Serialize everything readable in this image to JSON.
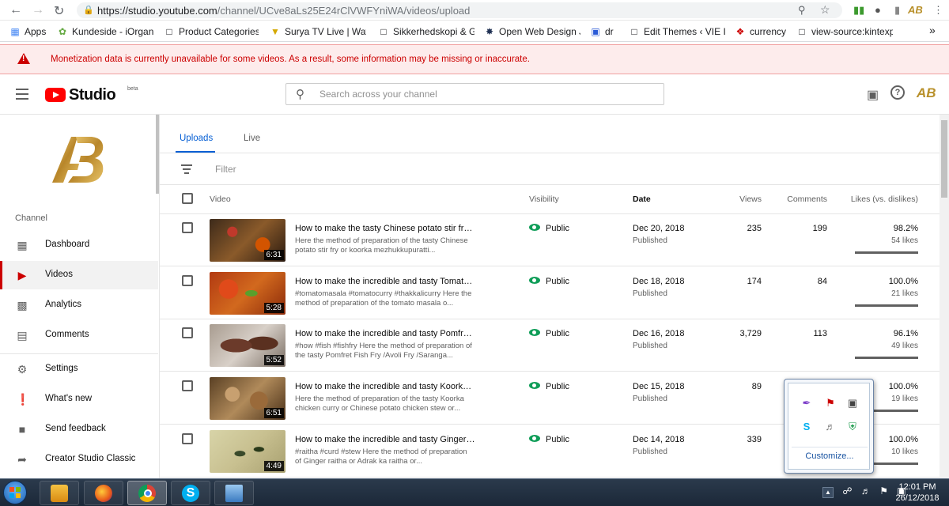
{
  "browser": {
    "url_host": "https://studio.youtube.com",
    "url_path": "/channel/UCve8aLs25E24rClVWFYniWA/videos/upload",
    "bookmarks": [
      "Apps",
      "Kundeside - iOrganic",
      "Product Categories ‹",
      "Surya TV Live | Watch",
      "Sikkerhedskopi & Ge",
      "Open Web Design Jo",
      "dr",
      "Edit Themes ‹ VIE INV",
      "currency",
      "view-source:kintexph"
    ],
    "more": "»"
  },
  "banner": {
    "message": "Monetization data is currently unavailable for some videos. As a result, some information may be missing or inaccurate."
  },
  "header": {
    "logo_text": "Studio",
    "beta": "beta",
    "search_placeholder": "Search across your channel"
  },
  "sidebar": {
    "section_label": "Channel",
    "items": [
      {
        "label": "Dashboard"
      },
      {
        "label": "Videos"
      },
      {
        "label": "Analytics"
      },
      {
        "label": "Comments"
      },
      {
        "label": "Settings"
      },
      {
        "label": "What's new"
      },
      {
        "label": "Send feedback"
      },
      {
        "label": "Creator Studio Classic"
      }
    ]
  },
  "main": {
    "tabs": [
      "Uploads",
      "Live"
    ],
    "filter_placeholder": "Filter",
    "columns": {
      "video": "Video",
      "visibility": "Visibility",
      "date": "Date",
      "views": "Views",
      "comments": "Comments",
      "likes": "Likes (vs. dislikes)"
    },
    "rows": [
      {
        "title": "How to make the tasty Chinese potato stir fry /...",
        "desc": "Here the method of preparation of the tasty Chinese potato stir fry or koorka mezhukkupuratti...",
        "duration": "6:31",
        "visibility": "Public",
        "date": "Dec 20, 2018",
        "status": "Published",
        "views": "235",
        "comments": "199",
        "likes_pct": "98.2%",
        "likes": "54 likes",
        "thumb_color": "#7a4a2a"
      },
      {
        "title": "How to make the incredible and tasty Tomato ...",
        "desc": "#tomatomasala #tomatocurry #thakkalicurry Here the method of preparation of the tomato masala o...",
        "duration": "5:28",
        "visibility": "Public",
        "date": "Dec 18, 2018",
        "status": "Published",
        "views": "174",
        "comments": "84",
        "likes_pct": "100.0%",
        "likes": "21 likes",
        "thumb_color": "#a8461f"
      },
      {
        "title": "How to make the incredible and tasty Pomfret ...",
        "desc": "#how #fish #fishfry Here the method of preparation of the tasty Pomfret Fish Fry /Avoli Fry /Saranga...",
        "duration": "5:52",
        "visibility": "Public",
        "date": "Dec 16, 2018",
        "status": "Published",
        "views": "3,729",
        "comments": "113",
        "likes_pct": "96.1%",
        "likes": "49 likes",
        "thumb_color": "#5b4d44"
      },
      {
        "title": "How to make the incredible and tasty Koorka c...",
        "desc": "Here the method of preparation of the tasty Koorka chicken curry or Chinese potato chicken stew or...",
        "duration": "6:51",
        "visibility": "Public",
        "date": "Dec 15, 2018",
        "status": "Published",
        "views": "89",
        "comments": "",
        "likes_pct": "100.0%",
        "likes": "19 likes",
        "thumb_color": "#8a6a3a"
      },
      {
        "title": "How to make the incredible and tasty Ginger R...",
        "desc": "#raitha #curd #stew Here the method of preparation of Ginger raitha or Adrak ka raitha or...",
        "duration": "4:49",
        "visibility": "Public",
        "date": "Dec 14, 2018",
        "status": "Published",
        "views": "339",
        "comments": "",
        "likes_pct": "100.0%",
        "likes": "10 likes",
        "thumb_color": "#b2ad7a"
      }
    ]
  },
  "tray_popup": {
    "customize": "Customize..."
  },
  "taskbar": {
    "time": "12:01 PM",
    "date": "26/12/2018"
  },
  "colors": {
    "accent_red": "#ff0000",
    "link_blue": "#065fd4",
    "public_green": "#0f9d58",
    "banner_red": "#cc0000"
  }
}
